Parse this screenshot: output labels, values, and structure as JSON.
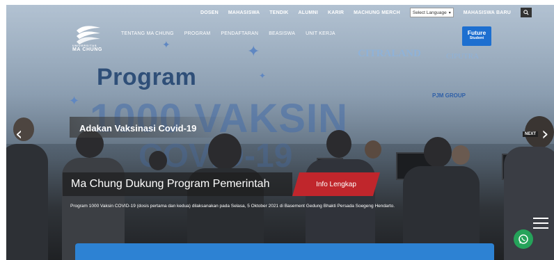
{
  "top_nav": {
    "items": [
      "DOSEN",
      "MAHASISWA",
      "TENDIK",
      "ALUMNI",
      "KARIR",
      "MACHUNG MERCH"
    ],
    "language_select": "Select Language",
    "mahasiswa_baru": "MAHASISWA BARU"
  },
  "logo": {
    "line1": "UNIVERSITAS",
    "line2": "MA CHUNG"
  },
  "main_nav": {
    "items": [
      "TENTANG MA CHUNG",
      "PROGRAM",
      "PENDAFTARAN",
      "BEASISWA",
      "UNIT KERJA"
    ]
  },
  "future_badge": {
    "title": "Future",
    "sub": "Student"
  },
  "sponsors": [
    "CITRALAND",
    "CIPUTRA",
    "PJM GROUP"
  ],
  "hero": {
    "poster_title": "Program",
    "poster_big": "1000 VAKSIN",
    "poster_big2": "COVID-19",
    "ribbon": "Adakan Vaksinasi Covid-19",
    "next_label": "NEXT",
    "caption_title": "Ma Chung Dukung Program Pemerintah",
    "info_button": "Info Lengkap",
    "description": "Program 1000 Vaksin COVID-19 (dosis pertama dan kedua) dilaksanakan pada Selasa, 5 Oktober 2021 di Basement Gedung Bhakti Persada Soegeng Hendarto."
  },
  "colors": {
    "info_button": "#c0262c",
    "future_badge": "#1d6fd0",
    "whatsapp": "#25a35a",
    "bottom_box": "#2d82d3"
  },
  "icons": [
    "search-icon",
    "chevron-left-icon",
    "chevron-right-icon",
    "hamburger-menu-icon",
    "whatsapp-icon"
  ]
}
